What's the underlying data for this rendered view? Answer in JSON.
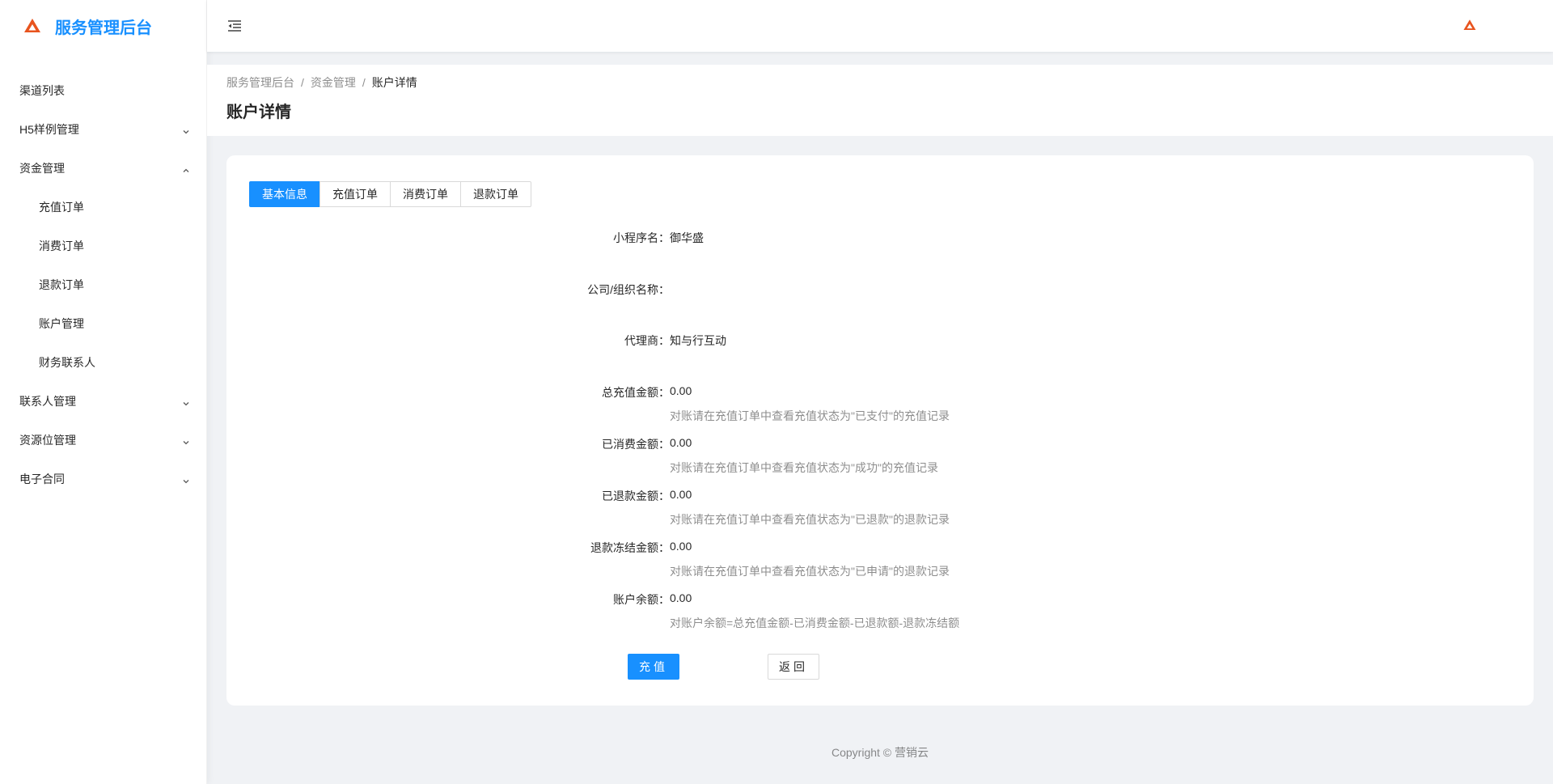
{
  "app": {
    "title": "服务管理后台",
    "brand_color": "#1890ff",
    "logo_color": "#e8541e"
  },
  "sidebar": {
    "items": [
      {
        "label": "渠道列表",
        "arrow": ""
      },
      {
        "label": "H5样例管理",
        "arrow": "down"
      },
      {
        "label": "资金管理",
        "arrow": "up"
      },
      {
        "label": "充值订单",
        "sub": true
      },
      {
        "label": "消费订单",
        "sub": true
      },
      {
        "label": "退款订单",
        "sub": true
      },
      {
        "label": "账户管理",
        "sub": true
      },
      {
        "label": "财务联系人",
        "sub": true
      },
      {
        "label": "联系人管理",
        "arrow": "down"
      },
      {
        "label": "资源位管理",
        "arrow": "down"
      },
      {
        "label": "电子合同",
        "arrow": "down"
      }
    ]
  },
  "breadcrumb": {
    "items": [
      "服务管理后台",
      "资金管理",
      "账户详情"
    ],
    "separator": "/"
  },
  "page": {
    "title": "账户详情"
  },
  "tabs": [
    {
      "label": "基本信息",
      "active": true
    },
    {
      "label": "充值订单",
      "active": false
    },
    {
      "label": "消费订单",
      "active": false
    },
    {
      "label": "退款订单",
      "active": false
    }
  ],
  "details": {
    "mini_program": {
      "label": "小程序名：",
      "value": "御华盛"
    },
    "company": {
      "label": "公司/组织名称：",
      "value": ""
    },
    "agent": {
      "label": "代理商：",
      "value": "知与行互动"
    },
    "total_recharge": {
      "label": "总充值金额：",
      "value": "0.00",
      "hint": "对账请在充值订单中查看充值状态为\"已支付\"的充值记录"
    },
    "consumed": {
      "label": "已消费金额：",
      "value": "0.00",
      "hint": "对账请在充值订单中查看充值状态为\"成功\"的充值记录"
    },
    "refunded": {
      "label": "已退款金额：",
      "value": "0.00",
      "hint": "对账请在充值订单中查看充值状态为\"已退款\"的退款记录"
    },
    "refund_frozen": {
      "label": "退款冻结金额：",
      "value": "0.00",
      "hint": "对账请在充值订单中查看充值状态为\"已申请\"的退款记录"
    },
    "balance": {
      "label": "账户余额：",
      "value": "0.00",
      "hint": "对账户余额=总充值金额-已消费金额-已退款额-退款冻结额"
    }
  },
  "buttons": {
    "recharge": "充值",
    "back": "返回"
  },
  "footer": {
    "text": "Copyright © 营销云"
  }
}
